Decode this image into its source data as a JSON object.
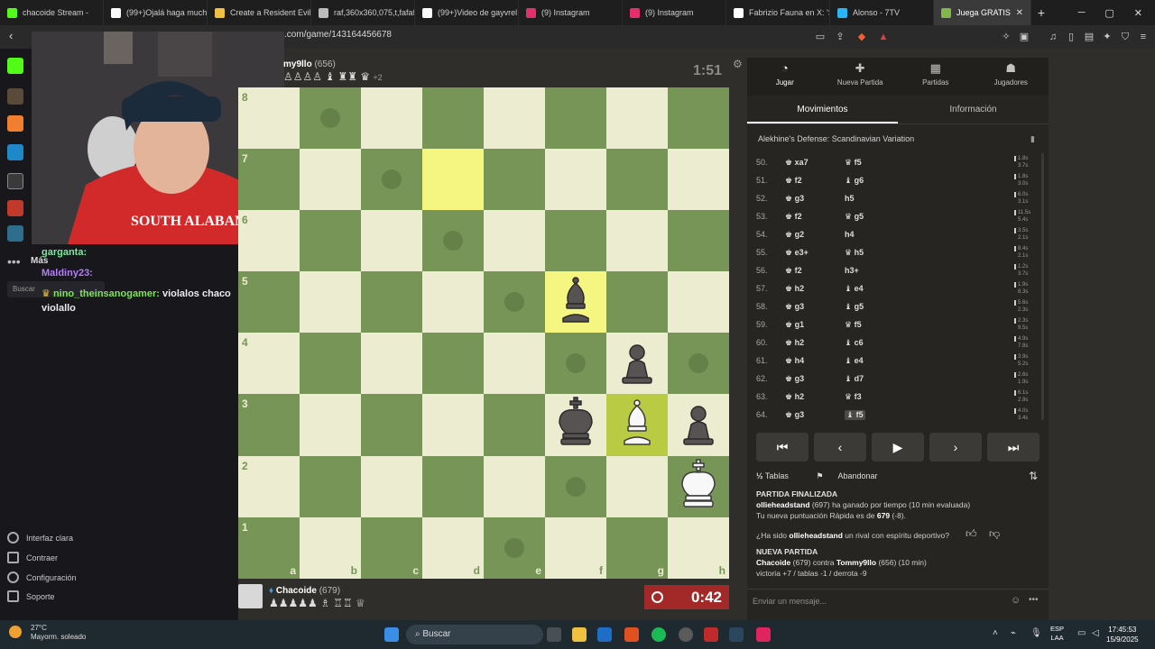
{
  "browser": {
    "tabs": [
      {
        "title": "chacoide Stream -",
        "color": "#53fc18"
      },
      {
        "title": "(99+)Ojalá haga much",
        "color": "#ffffff"
      },
      {
        "title": "Create a Resident Evil",
        "color": "#f0c040"
      },
      {
        "title": "raf,360x360,075,t,fafafa",
        "color": "#bbbbbb"
      },
      {
        "title": "(99+)Video de gayvrel",
        "color": "#ffffff"
      },
      {
        "title": "(9) Instagram",
        "color": "#e1306c"
      },
      {
        "title": "(9) Instagram",
        "color": "#e1306c"
      },
      {
        "title": "Fabrizio Fauna en X: 'S",
        "color": "#ffffff"
      },
      {
        "title": "Alonso - 7TV",
        "color": "#29b6f6"
      },
      {
        "title": "Juega GRATIS",
        "color": "#81b64c"
      }
    ],
    "url": "s.com/game/143164456678"
  },
  "stream": {
    "chat": [
      {
        "user": "garganta:",
        "color": "#7fe7a0",
        "text": ""
      },
      {
        "user": "Maldiny23:",
        "color": "#b47cff",
        "text": ""
      },
      {
        "user": "nino_theinsanogamer:",
        "color": "#7fe35a",
        "text": "violalos chaco"
      },
      {
        "user": "",
        "color": "#eaeaea",
        "text": "violallo"
      }
    ],
    "mas_label": "Más",
    "search_label": "Buscar",
    "menu": [
      "Interfaz clara",
      "Contraer",
      "Configuración",
      "Soporte"
    ]
  },
  "game": {
    "opponent": {
      "name": "my9llo",
      "rating": "(656)",
      "captured": "♙♙♙♙ ♝ ♜♜ ♛",
      "plus": "+2",
      "clock": "1:51"
    },
    "me": {
      "name": "Chacoide",
      "rating": "(679)",
      "captured": "♟♟♟♟♟ ♗ ♖♖ ♕",
      "clock": "0:42"
    },
    "files": [
      "a",
      "b",
      "c",
      "d",
      "e",
      "f",
      "g",
      "h"
    ],
    "ranks": [
      "8",
      "7",
      "6",
      "5",
      "4",
      "3",
      "2",
      "1"
    ],
    "board_rows": [
      "........",
      "........",
      "........",
      ".....b..",
      "......p.",
      ".....kBp",
      ".......K",
      "........"
    ],
    "highlights": [
      "d7",
      "f5",
      "g3"
    ],
    "dots": [
      "b8",
      "c7",
      "d6",
      "e5",
      "f4",
      "h4",
      "f2",
      "e1"
    ]
  },
  "panel": {
    "tabs": [
      {
        "label": "Jugar",
        "icon": "◔"
      },
      {
        "label": "Nueva Partida",
        "icon": "✚"
      },
      {
        "label": "Partidas",
        "icon": "▦"
      },
      {
        "label": "Jugadores",
        "icon": "☗"
      }
    ],
    "subtabs": [
      "Movimientos",
      "Información"
    ],
    "opening": "Alekhine's Defense: Scandinavian Variation",
    "moves": [
      {
        "n": "50.",
        "w": "♚ xa7",
        "b": "♛ f5",
        "t1": "1.8s",
        "t2": "3.7s"
      },
      {
        "n": "51.",
        "w": "♚ f2",
        "b": "♝ g6",
        "t1": "1.8s",
        "t2": "3.0s"
      },
      {
        "n": "52.",
        "w": "♚ g3",
        "b": "h5",
        "t1": "6.0s",
        "t2": "3.1s"
      },
      {
        "n": "53.",
        "w": "♚ f2",
        "b": "♛ g5",
        "t1": "11.5s",
        "t2": "5.4s"
      },
      {
        "n": "54.",
        "w": "♚ g2",
        "b": "h4",
        "t1": "3.5s",
        "t2": "2.1s"
      },
      {
        "n": "55.",
        "w": "♚ e3+",
        "b": "♛ h5",
        "t1": "8.4s",
        "t2": "2.1s"
      },
      {
        "n": "56.",
        "w": "♚ f2",
        "b": "h3+",
        "t1": "1.2s",
        "t2": "3.7s"
      },
      {
        "n": "57.",
        "w": "♚ h2",
        "b": "♝ e4",
        "t1": "1.9s",
        "t2": "8.3s"
      },
      {
        "n": "58.",
        "w": "♚ g3",
        "b": "♝ g5",
        "t1": "5.6s",
        "t2": "2.3s"
      },
      {
        "n": "59.",
        "w": "♚ g1",
        "b": "♛ f5",
        "t1": "2.3s",
        "t2": "9.5s"
      },
      {
        "n": "60.",
        "w": "♚ h2",
        "b": "♝ c6",
        "t1": "4.9s",
        "t2": "7.8s"
      },
      {
        "n": "61.",
        "w": "♚ h4",
        "b": "♝ e4",
        "t1": "3.9s",
        "t2": "5.2s"
      },
      {
        "n": "62.",
        "w": "♚ g3",
        "b": "♝ d7",
        "t1": "2.6s",
        "t2": "1.9s"
      },
      {
        "n": "63.",
        "w": "♚ h2",
        "b": "♛ f3",
        "t1": "6.1s",
        "t2": "2.9s"
      },
      {
        "n": "64.",
        "w": "♚ g3",
        "b": "♝ f5",
        "t1": "4.0s",
        "t2": "3.4s"
      }
    ],
    "draw_label": "Tablas",
    "draw_prefix": "½",
    "resign_label": "Abandonar",
    "log": {
      "finished": "PARTIDA FINALIZADA",
      "result_winner": "ollieheadstand",
      "result_rest": " (697) ha ganado por tiempo (10 min evaluada)",
      "rating_pre": "Tu nueva puntuación Rápida es de ",
      "rating_val": "679",
      "rating_post": " (-8).",
      "q_pre": "¿Ha sido ",
      "q_name": "ollieheadstand",
      "q_post": " un rival con espíritu deportivo?",
      "new_game": "NUEVA PARTIDA",
      "match_a": "Chacoide",
      "match_mid": " (679) contra ",
      "match_b": "Tommy9llo",
      "match_post": " (656) (10 min)",
      "record": "victoria +7 / tablas -1 / derrota -9"
    },
    "msg_placeholder": "Enviar un mensaje..."
  },
  "taskbar": {
    "temp": "27°C",
    "weather": "Mayorm. soleado",
    "search": "Buscar",
    "lang1": "ESP",
    "lang2": "LAA",
    "time": "17:45:53",
    "date": "15/9/2025"
  }
}
